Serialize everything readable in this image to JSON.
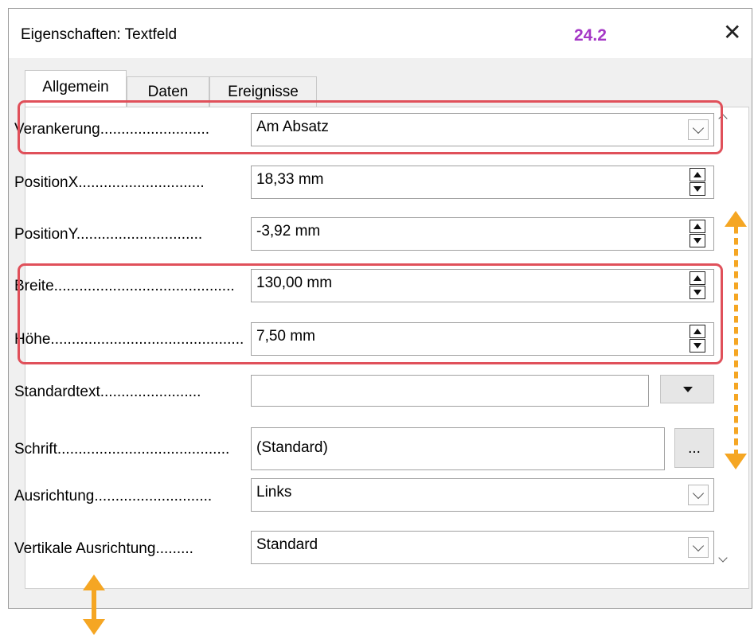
{
  "window": {
    "title": "Eigenschaften: Textfeld",
    "version_label": "24.2",
    "close_glyph": "✕"
  },
  "tabs": [
    {
      "label": "Allgemein",
      "active": true
    },
    {
      "label": "Daten",
      "active": false
    },
    {
      "label": "Ereignisse",
      "active": false
    }
  ],
  "fields": {
    "anchor": {
      "label": "Verankerung",
      "dots": "..........................",
      "value": "Am Absatz"
    },
    "position_x": {
      "label": "PositionX",
      "dots": "..............................",
      "value": "18,33 mm"
    },
    "position_y": {
      "label": "PositionY",
      "dots": "..............................",
      "value": "-3,92 mm"
    },
    "width": {
      "label": "Breite",
      "dots": "...........................................",
      "value": "130,00 mm"
    },
    "height": {
      "label": "Höhe",
      "dots": "..............................................",
      "value": "7,50 mm"
    },
    "default_text": {
      "label": "Standardtext",
      "dots": "........................",
      "value": ""
    },
    "font": {
      "label": "Schrift",
      "dots": ".........................................",
      "value": "(Standard)",
      "button": "..."
    },
    "alignment": {
      "label": "Ausrichtung",
      "dots": "............................",
      "value": "Links"
    },
    "vertical_alignment": {
      "label": "Vertikale Ausrichtung",
      "dots": ".........",
      "value": "Standard"
    }
  },
  "colors": {
    "highlight": "#e0505a",
    "annotation_arrow": "#f5a623",
    "version_text": "#a538c6"
  }
}
